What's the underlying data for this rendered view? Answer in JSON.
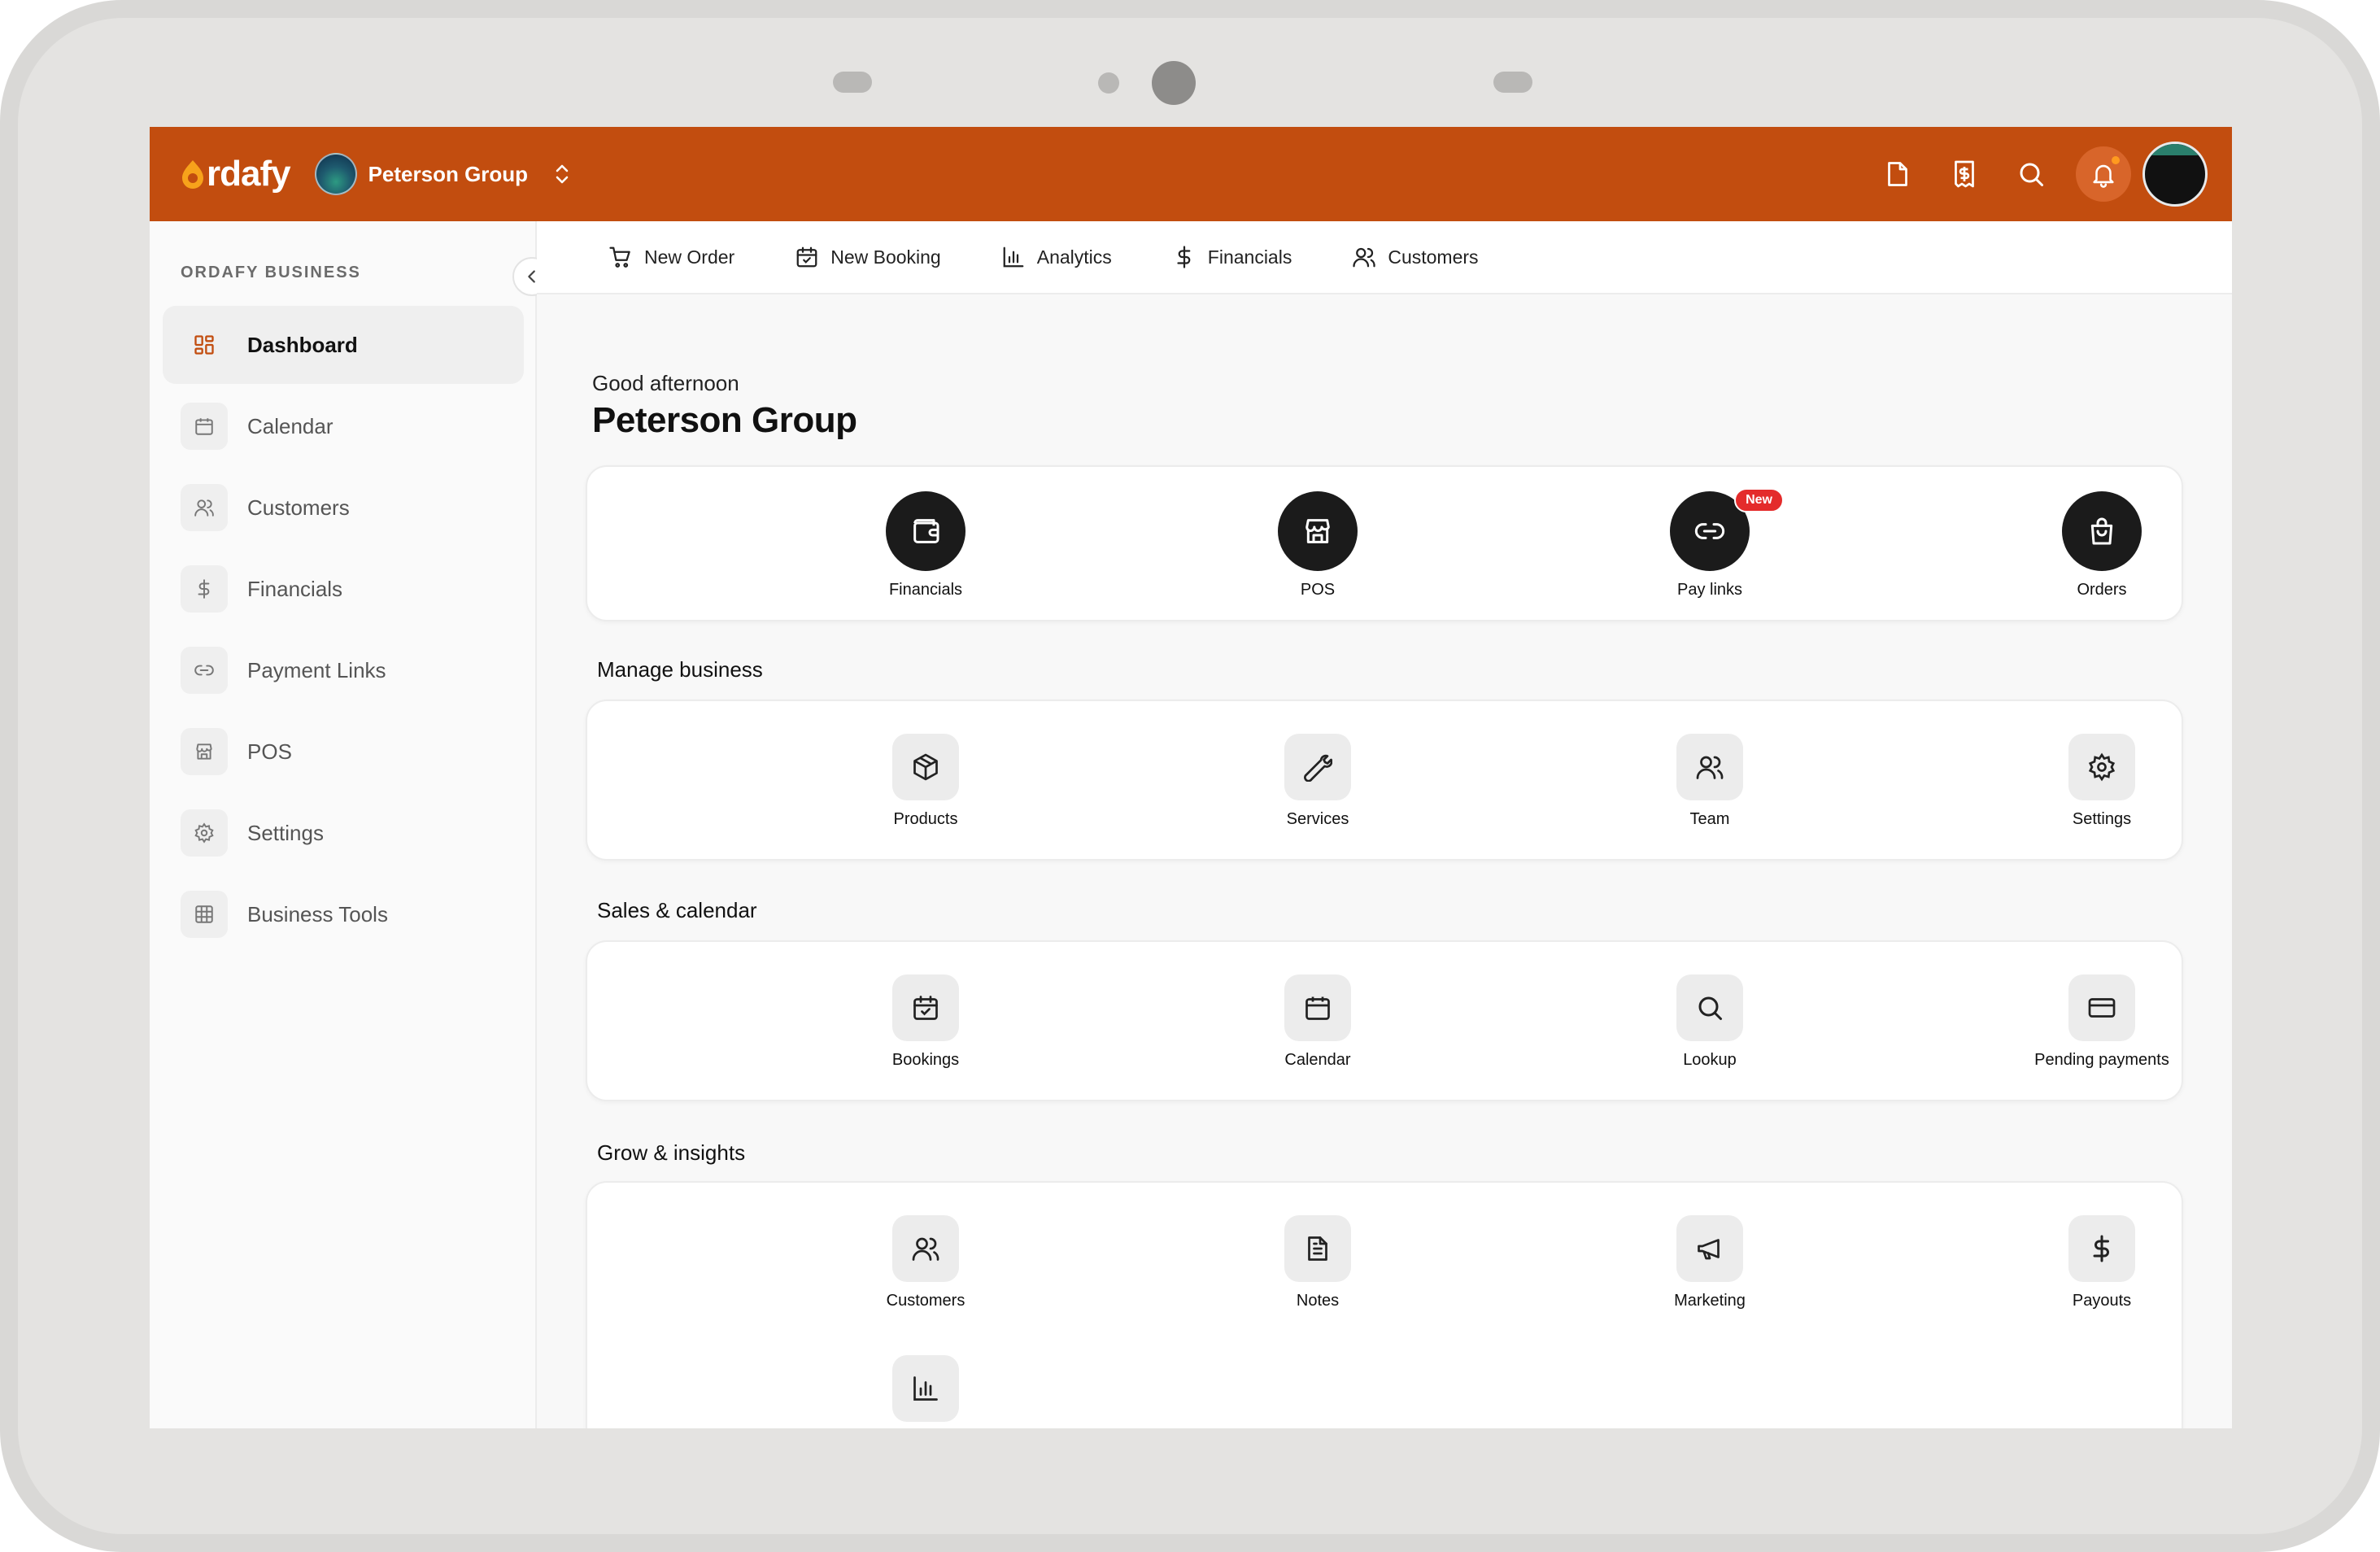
{
  "brand": {
    "logo_text": "rdafy",
    "accent_color": "#c24d0f"
  },
  "org": {
    "name": "Peterson Group"
  },
  "topbar_actions": [
    "document-icon",
    "receipt-icon",
    "search-icon",
    "bell-icon"
  ],
  "sidebar": {
    "section": "ORDAFY BUSINESS",
    "items": [
      {
        "label": "Dashboard",
        "icon": "dashboard-icon",
        "active": true
      },
      {
        "label": "Calendar",
        "icon": "calendar-icon"
      },
      {
        "label": "Customers",
        "icon": "users-icon"
      },
      {
        "label": "Financials",
        "icon": "dollar-icon"
      },
      {
        "label": "Payment Links",
        "icon": "link-icon"
      },
      {
        "label": "POS",
        "icon": "store-icon"
      },
      {
        "label": "Settings",
        "icon": "gear-icon"
      },
      {
        "label": "Business Tools",
        "icon": "grid-icon"
      }
    ]
  },
  "quicknav": [
    {
      "label": "New Order",
      "icon": "cart-icon"
    },
    {
      "label": "New Booking",
      "icon": "calendar-check-icon"
    },
    {
      "label": "Analytics",
      "icon": "bar-chart-icon"
    },
    {
      "label": "Financials",
      "icon": "dollar-icon"
    },
    {
      "label": "Customers",
      "icon": "users-icon"
    }
  ],
  "main": {
    "greeting": "Good afternoon",
    "title": "Peterson Group",
    "primary_tiles": [
      {
        "label": "Financials",
        "icon": "wallet-icon"
      },
      {
        "label": "POS",
        "icon": "store-icon"
      },
      {
        "label": "Pay links",
        "icon": "link-icon",
        "badge": "New"
      },
      {
        "label": "Orders",
        "icon": "bag-icon"
      }
    ],
    "sections": [
      {
        "title": "Manage business",
        "tiles": [
          {
            "label": "Products",
            "icon": "box-icon"
          },
          {
            "label": "Services",
            "icon": "wrench-icon"
          },
          {
            "label": "Team",
            "icon": "users-icon"
          },
          {
            "label": "Settings",
            "icon": "gear-icon"
          }
        ]
      },
      {
        "title": "Sales & calendar",
        "tiles": [
          {
            "label": "Bookings",
            "icon": "calendar-check-icon"
          },
          {
            "label": "Calendar",
            "icon": "calendar-icon"
          },
          {
            "label": "Lookup",
            "icon": "search-icon"
          },
          {
            "label": "Pending payments",
            "icon": "card-icon"
          }
        ]
      },
      {
        "title": "Grow & insights",
        "tiles": [
          {
            "label": "Customers",
            "icon": "users-icon"
          },
          {
            "label": "Notes",
            "icon": "file-text-icon"
          },
          {
            "label": "Marketing",
            "icon": "megaphone-icon"
          },
          {
            "label": "Payouts",
            "icon": "dollar-icon"
          },
          {
            "label": "",
            "icon": "bar-chart-icon"
          }
        ]
      }
    ]
  }
}
